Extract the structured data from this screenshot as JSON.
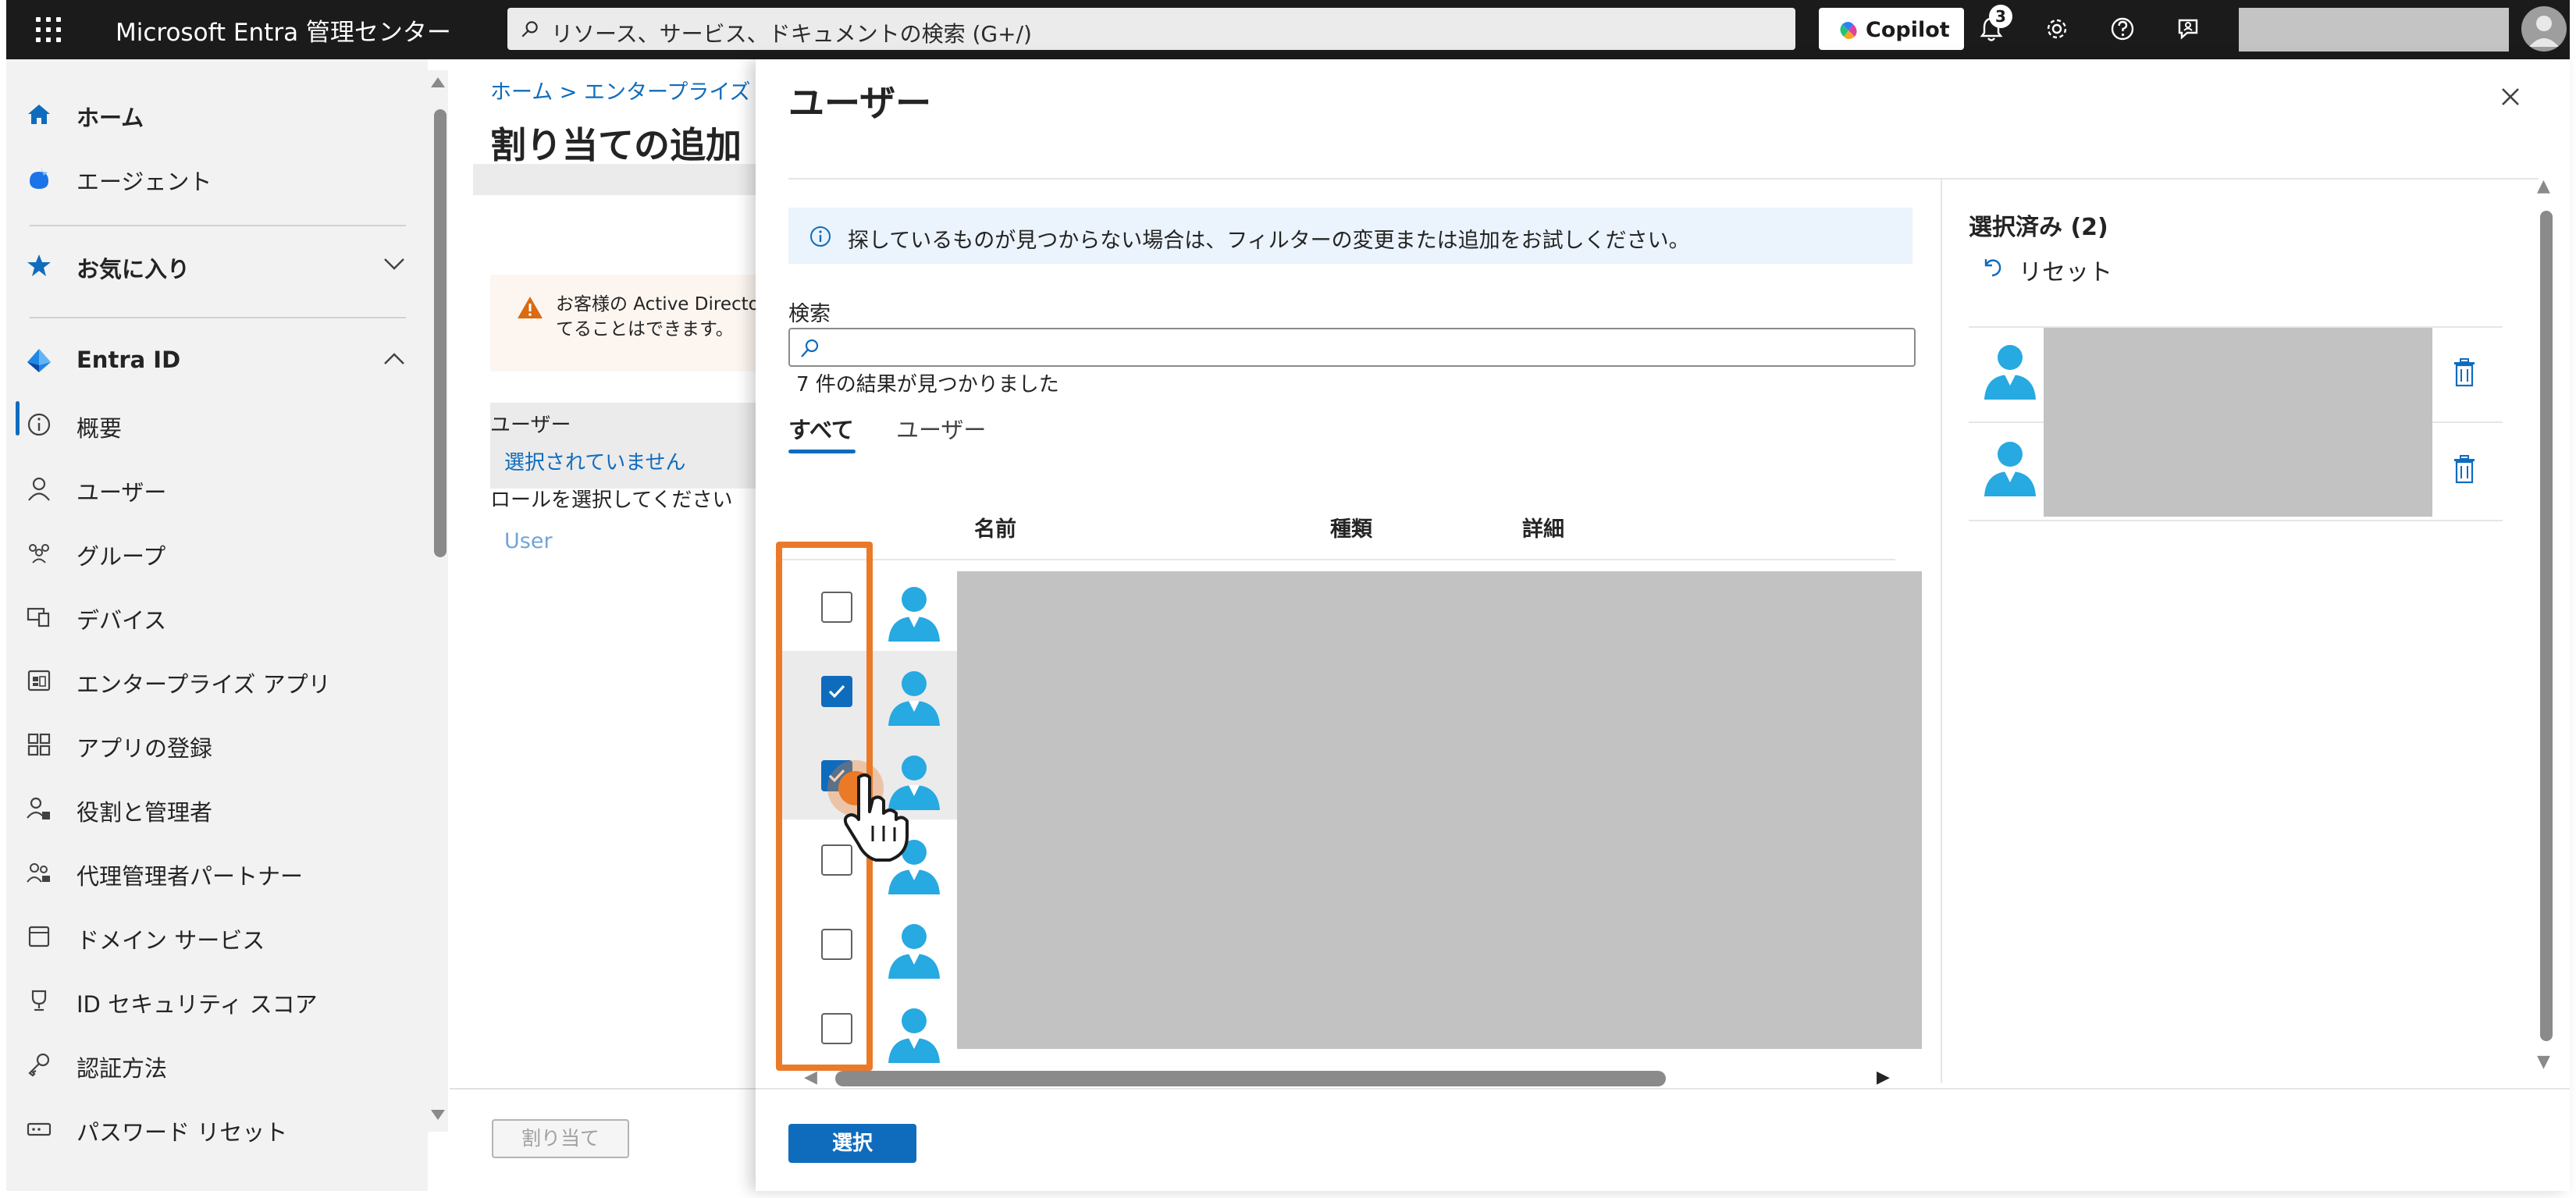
{
  "header": {
    "app_title": "Microsoft Entra 管理センター",
    "search_placeholder": "リソース、サービス、ドキュメントの検索 (G+/)",
    "copilot_label": "Copilot",
    "notification_count": "3"
  },
  "sidebar": {
    "items": [
      {
        "label": "ホーム",
        "icon": "home-icon"
      },
      {
        "label": "エージェント",
        "icon": "agent-icon"
      },
      {
        "label": "お気に入り",
        "icon": "star-icon"
      },
      {
        "label": "Entra ID",
        "icon": "entra-icon"
      },
      {
        "label": "概要",
        "icon": "info-icon"
      },
      {
        "label": "ユーザー",
        "icon": "person-icon"
      },
      {
        "label": "グループ",
        "icon": "group-icon"
      },
      {
        "label": "デバイス",
        "icon": "device-icon"
      },
      {
        "label": "エンタープライズ アプリ",
        "icon": "app-icon"
      },
      {
        "label": "アプリの登録",
        "icon": "grid-icon"
      },
      {
        "label": "役割と管理者",
        "icon": "role-icon"
      },
      {
        "label": "代理管理者パートナー",
        "icon": "partner-icon"
      },
      {
        "label": "ドメイン サービス",
        "icon": "domain-icon"
      },
      {
        "label": "ID セキュリティ スコア",
        "icon": "trophy-icon"
      },
      {
        "label": "認証方法",
        "icon": "key-icon"
      },
      {
        "label": "パスワード リセット",
        "icon": "password-icon"
      }
    ],
    "collapse_glyph": "«"
  },
  "background_page": {
    "breadcrumb": "ホーム > エンタープライズ アプ",
    "title": "割り当ての追加",
    "warning": "お客様の Active Directo 当てることはできます。",
    "users_label": "ユーザー",
    "users_value": "選択されていません",
    "role_label": "ロールを選択してください",
    "role_value": "User",
    "assign_button": "割り当て"
  },
  "panel": {
    "title": "ユーザー",
    "info_text": "探しているものが見つからない場合は、フィルターの変更または追加をお試しください。",
    "search_label": "検索",
    "search_value": "",
    "result_count": "7 件の結果が見つかりました",
    "tabs": [
      {
        "label": "すべて",
        "active": true
      },
      {
        "label": "ユーザー",
        "active": false
      }
    ],
    "columns": [
      "名前",
      "種類",
      "詳細"
    ],
    "rows": [
      {
        "checked": false
      },
      {
        "checked": true
      },
      {
        "checked": true
      },
      {
        "checked": false
      },
      {
        "checked": false
      },
      {
        "checked": false
      }
    ],
    "select_button": "選択",
    "selected_title": "選択済み (2)",
    "reset_label": "リセット"
  },
  "colors": {
    "accent": "#0f6cbd",
    "highlight_box": "#ea7a28",
    "redaction": "#c2c2c2",
    "topbar": "#1b1b1b"
  }
}
